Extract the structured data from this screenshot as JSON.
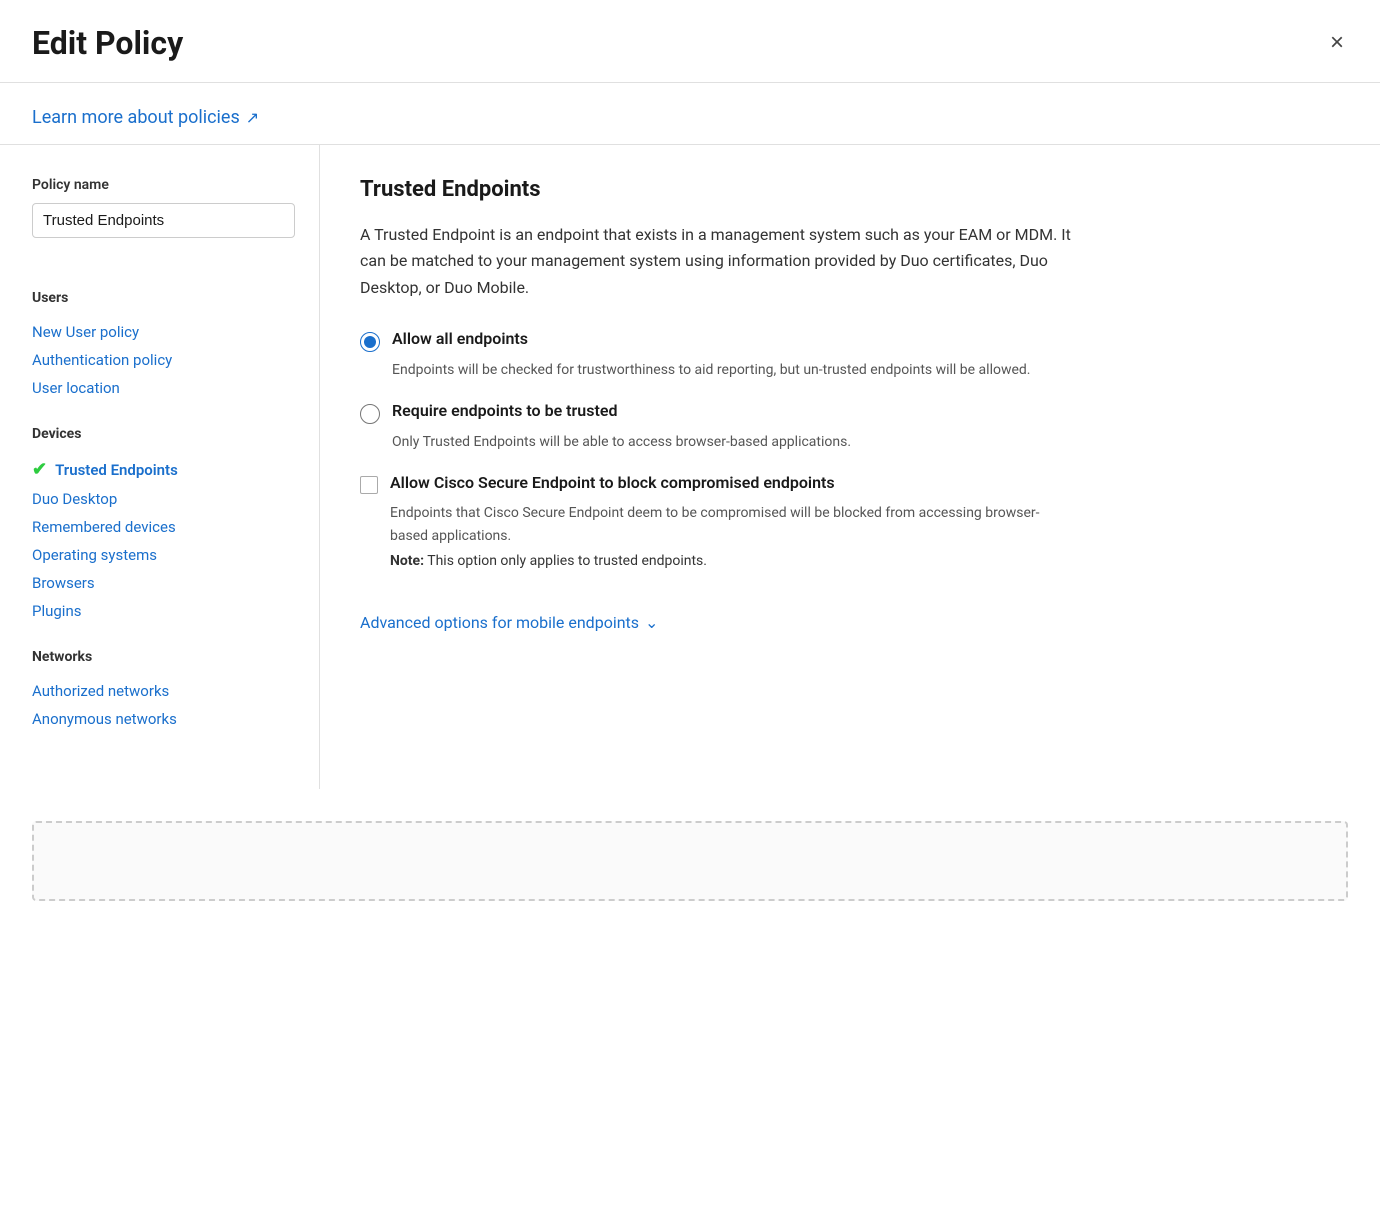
{
  "header": {
    "title": "Edit Policy",
    "close_label": "×"
  },
  "learn_more": {
    "text": "Learn more about policies",
    "icon": "external-link-icon"
  },
  "sidebar": {
    "policy_name_label": "Policy name",
    "policy_name_value": "Trusted Endpoints",
    "sections": [
      {
        "label": "Users",
        "items": [
          {
            "id": "new-user-policy",
            "text": "New User policy",
            "active": false,
            "check": false
          },
          {
            "id": "authentication-policy",
            "text": "Authentication policy",
            "active": false,
            "check": false
          },
          {
            "id": "user-location",
            "text": "User location",
            "active": false,
            "check": false
          }
        ]
      },
      {
        "label": "Devices",
        "items": [
          {
            "id": "trusted-endpoints",
            "text": "Trusted Endpoints",
            "active": true,
            "check": true
          },
          {
            "id": "duo-desktop",
            "text": "Duo Desktop",
            "active": false,
            "check": false
          },
          {
            "id": "remembered-devices",
            "text": "Remembered devices",
            "active": false,
            "check": false
          },
          {
            "id": "operating-systems",
            "text": "Operating systems",
            "active": false,
            "check": false
          },
          {
            "id": "browsers",
            "text": "Browsers",
            "active": false,
            "check": false
          },
          {
            "id": "plugins",
            "text": "Plugins",
            "active": false,
            "check": false
          }
        ]
      },
      {
        "label": "Networks",
        "items": [
          {
            "id": "authorized-networks",
            "text": "Authorized networks",
            "active": false,
            "check": false
          },
          {
            "id": "anonymous-networks",
            "text": "Anonymous networks",
            "active": false,
            "check": false
          }
        ]
      }
    ]
  },
  "main": {
    "section_title": "Trusted Endpoints",
    "description": "A Trusted Endpoint is an endpoint that exists in a management system such as your EAM or MDM. It can be matched to your management system using information provided by Duo certificates, Duo Desktop, or Duo Mobile.",
    "options": [
      {
        "type": "radio",
        "id": "allow-all",
        "label": "Allow all endpoints",
        "checked": true,
        "description": "Endpoints will be checked for trustworthiness to aid reporting, but un-trusted endpoints will be allowed."
      },
      {
        "type": "radio",
        "id": "require-trusted",
        "label": "Require endpoints to be trusted",
        "checked": false,
        "description": "Only Trusted Endpoints will be able to access browser-based applications."
      }
    ],
    "checkbox_option": {
      "id": "allow-cisco",
      "label": "Allow Cisco Secure Endpoint to block compromised endpoints",
      "checked": false,
      "description": "Endpoints that Cisco Secure Endpoint deem to be compromised will be blocked from accessing browser-based applications.",
      "note_prefix": "Note:",
      "note_text": " This option only applies to trusted endpoints."
    },
    "advanced_link": "Advanced options for mobile endpoints",
    "advanced_icon": "chevron-down-icon"
  }
}
